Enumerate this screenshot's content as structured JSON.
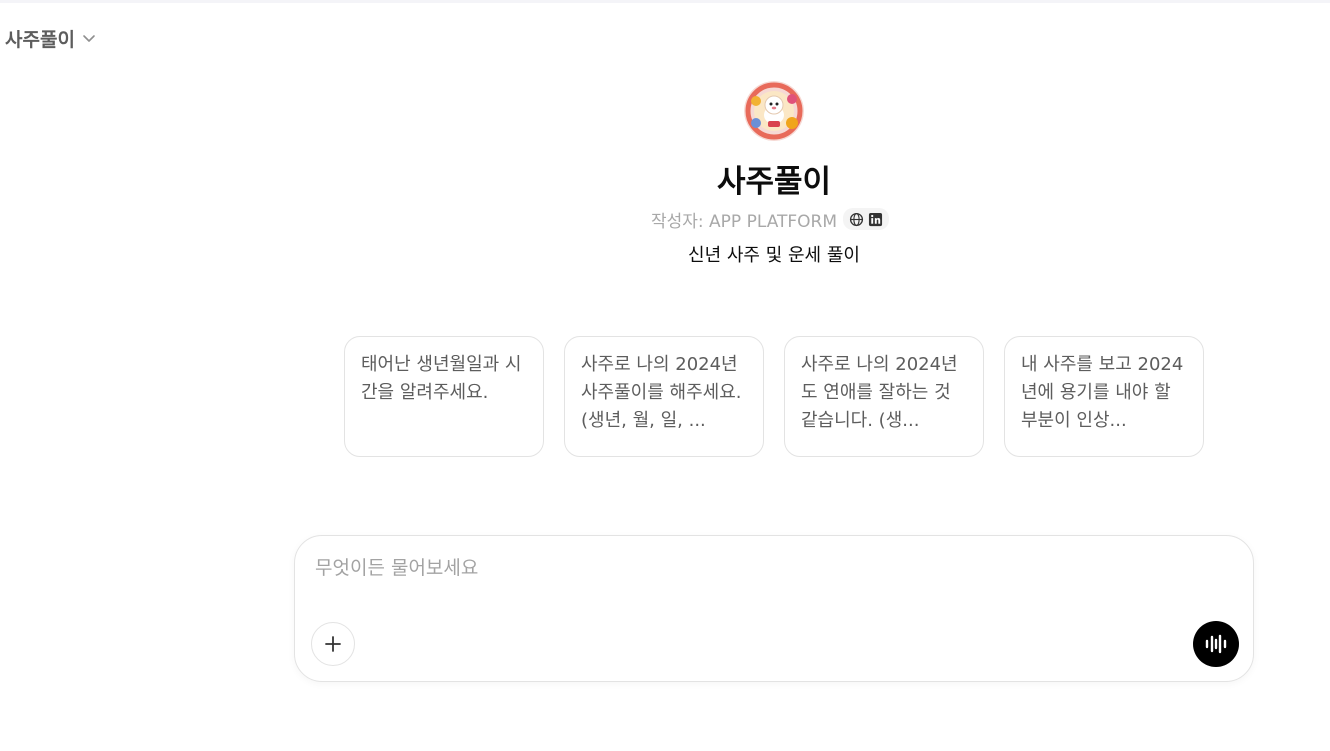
{
  "header": {
    "model_name": "사주풀이",
    "chevron_icon": "chevron-down-icon"
  },
  "gpt": {
    "title": "사주풀이",
    "author": "작성자: APP PLATFORM",
    "links": [
      "globe-icon",
      "linkedin-icon"
    ],
    "description": "신년 사주 및 운세 풀이"
  },
  "starters": [
    {
      "text": "태어난 생년월일과 시간을 알려주세요."
    },
    {
      "text": "사주로 나의 2024년 사주풀이를 해주세요. (생년, 월, 일, ..."
    },
    {
      "text": "사주로 나의 2024년도 연애를 잘하는 것 같습니다. (생..."
    },
    {
      "text": "내 사주를 보고 2024년에 용기를 내야 할 부분이 인상..."
    }
  ],
  "composer": {
    "placeholder": "무엇이든 물어보세요",
    "value": "",
    "attach_icon": "plus-icon",
    "voice_icon": "voice-wave-icon"
  },
  "colors": {
    "text_primary": "#0d0d0d",
    "text_secondary": "#5d5d5d",
    "text_muted": "#a8a8a8",
    "border": "#e3e3e3",
    "voice_button": "#000000"
  }
}
